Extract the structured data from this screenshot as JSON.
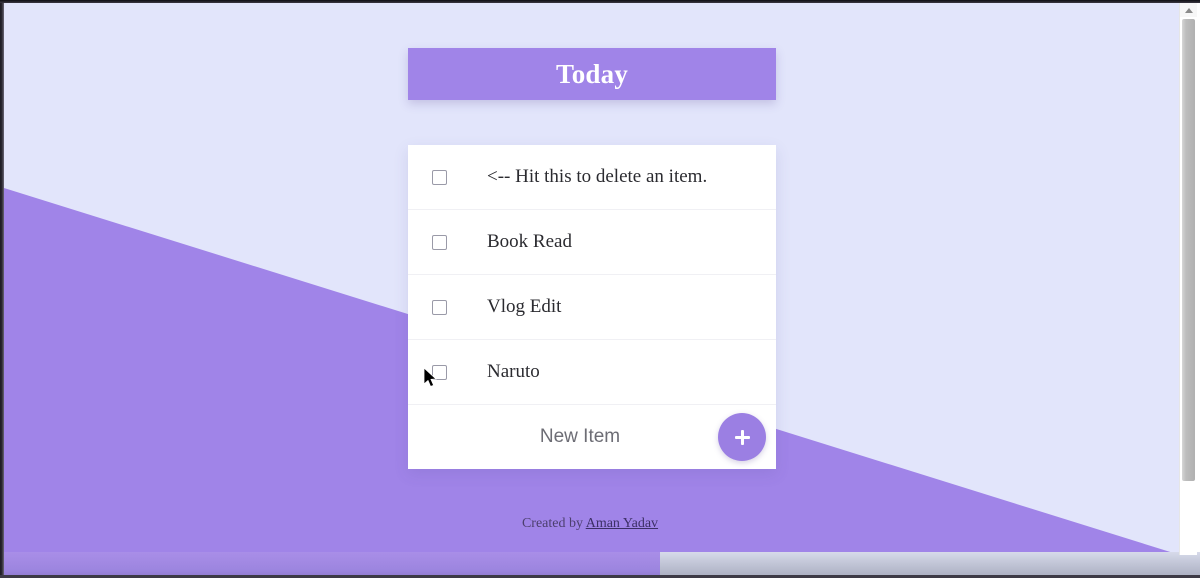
{
  "app": {
    "header_title": "Today",
    "footer_prefix": "Created by",
    "footer_author": "Aman Yadav",
    "accent_color": "#a084e8",
    "background_color": "#e2e5fb",
    "card_color": "#ffffff",
    "add_button_color": "#9b7fe3"
  },
  "todos": [
    {
      "label": "<-- Hit this to delete an item.",
      "checked": false
    },
    {
      "label": "Book Read",
      "checked": false
    },
    {
      "label": "Vlog Edit",
      "checked": false
    },
    {
      "label": "Naruto",
      "checked": false
    }
  ],
  "new_item": {
    "placeholder": "New Item",
    "value": "",
    "add_label": "+"
  },
  "scrollbar": {
    "up_arrow": "scroll-up-arrow"
  }
}
